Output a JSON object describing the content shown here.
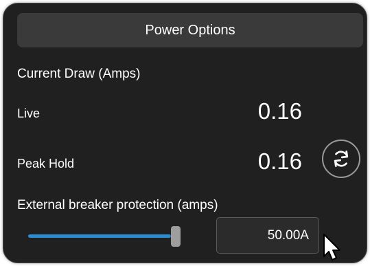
{
  "header": {
    "title": "Power Options"
  },
  "current_draw": {
    "section_label": "Current Draw (Amps)",
    "live_label": "Live",
    "live_value": "0.16",
    "peak_label": "Peak Hold",
    "peak_value": "0.16",
    "reset_icon": "refresh-icon"
  },
  "breaker": {
    "label": "External breaker protection (amps)",
    "slider_fraction": 0.92,
    "value": "50.00A"
  },
  "colors": {
    "panel_background": "#202020",
    "header_background": "#3a3a3a",
    "slider_track": "#2a8bd0",
    "slider_thumb": "#9e9e9e",
    "text": "#ffffff"
  },
  "cursor_icon": "mouse-pointer-icon"
}
